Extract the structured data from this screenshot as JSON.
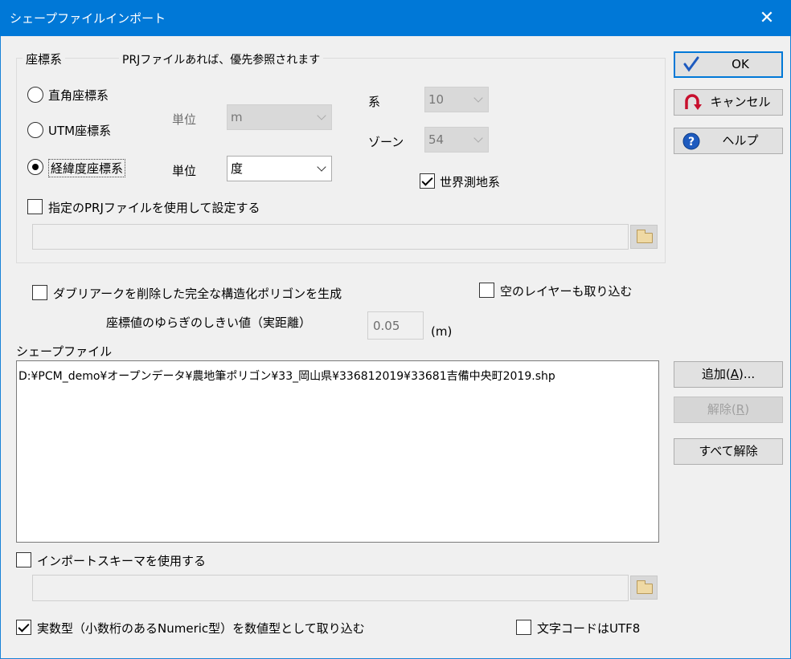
{
  "window": {
    "title": "シェープファイルインポート",
    "close_glyph": "✕"
  },
  "coordinate_system": {
    "group_label": "座標系",
    "prj_note": "PRJファイルあれば、優先参照されます",
    "options": [
      {
        "label": "直角座標系",
        "checked": false
      },
      {
        "label": "UTM座標系",
        "checked": false
      },
      {
        "label": "経緯度座標系",
        "checked": true
      }
    ],
    "unit_label_1": "単位",
    "unit_value_1": "m",
    "unit_label_2": "単位",
    "unit_value_2": "度",
    "system_label": "系",
    "system_value": "10",
    "zone_label": "ゾーン",
    "zone_value": "54",
    "wgs_label": "世界測地系",
    "wgs_checked": true,
    "use_prj_label": "指定のPRJファイルを使用して設定する",
    "use_prj_checked": false,
    "prj_path": ""
  },
  "options": {
    "polygon_label": "ダブリアークを削除した完全な構造化ポリゴンを生成",
    "polygon_checked": false,
    "empty_layer_label": "空のレイヤーも取り込む",
    "empty_layer_checked": false,
    "threshold_label": "座標値のゆらぎのしきい値（実距離）",
    "threshold_value": "0.05",
    "threshold_unit": "(m)"
  },
  "shapefiles": {
    "label": "シェープファイル",
    "items": [
      "D:¥PCM_demo¥オープンデータ¥農地筆ポリゴン¥33_岡山県¥336812019¥33681吉備中央町2019.shp"
    ]
  },
  "schema": {
    "label": "インポートスキーマを使用する",
    "checked": false,
    "path": ""
  },
  "numeric": {
    "label": "実数型（小数桁のあるNumeric型）を数値型として取り込む",
    "checked": true
  },
  "utf8": {
    "label": "文字コードはUTF8",
    "checked": false
  },
  "buttons": {
    "ok": "OK",
    "cancel": "キャンセル",
    "help": "ヘルプ",
    "add_text": "追加",
    "add_key": "A",
    "remove_text": "解除",
    "remove_key": "R",
    "remove_all": "すべて解除"
  },
  "colors": {
    "titlebar": "#0078d7",
    "ok_check": "#1e5bbf",
    "cancel_icon": "#c8102e",
    "help_icon": "#1e5bbf"
  }
}
